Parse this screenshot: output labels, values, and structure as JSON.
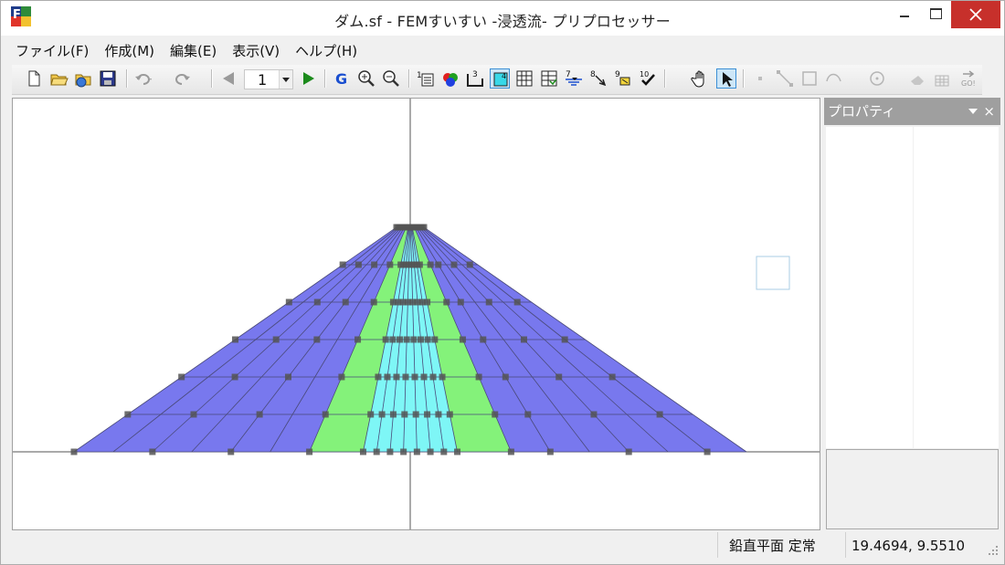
{
  "window": {
    "title": "ダム.sf - FEMすいすい -浸透流- プリプロセッサー"
  },
  "menu": {
    "items": [
      {
        "label": "ファイル(F)"
      },
      {
        "label": "作成(M)"
      },
      {
        "label": "編集(E)"
      },
      {
        "label": "表示(V)"
      },
      {
        "label": "ヘルプ(H)"
      }
    ]
  },
  "toolbar": {
    "step_value": "1",
    "zoom_fit_label": "G",
    "icons": [
      "new-file-icon",
      "open-folder-icon",
      "open-web-icon",
      "save-icon",
      "undo-icon",
      "redo-icon",
      "previous-step-icon",
      "next-step-icon",
      "zoom-fit-icon",
      "zoom-in-icon",
      "zoom-out-icon",
      "node-number-icon",
      "material-color-icon",
      "element-number-icon",
      "mesh-display-icon",
      "grid-icon",
      "table-icon",
      "water-level-icon",
      "boundary-icon",
      "flux-icon",
      "check-icon",
      "pan-hand-icon",
      "select-arrow-icon",
      "point-icon",
      "line-icon",
      "rectangle-icon",
      "curve-icon",
      "circle-icon",
      "eraser-icon",
      "mesh-generate-icon",
      "go-icon"
    ]
  },
  "property_panel": {
    "title": "プロパティ",
    "close_label": "×"
  },
  "status": {
    "plane": "鉛直平面",
    "mode": "定常",
    "coords": "19.4694, 9.5510"
  },
  "colors": {
    "outer_zone": "#7878ee",
    "filter_zone": "#84f27a",
    "core_zone": "#7ef6f6",
    "mesh_line": "#4a4a7a",
    "node": "#555555"
  },
  "icon_semantics": {
    "app": "app-logo-icon",
    "close": "close-icon",
    "minimize": "minimize-icon",
    "maximize": "maximize-icon",
    "panel_pin": "chevron-down-icon",
    "grip": "resize-grip-icon"
  }
}
